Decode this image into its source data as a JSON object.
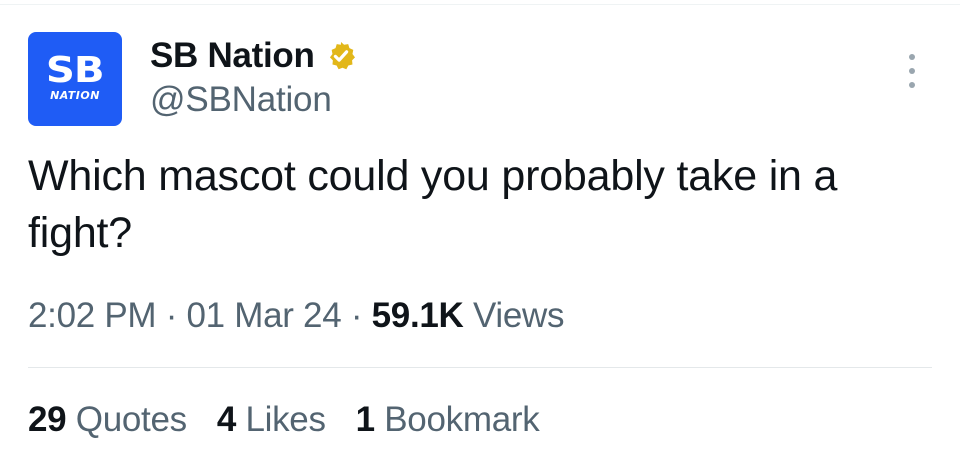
{
  "account": {
    "avatar_text_top": "SB",
    "avatar_text_bottom": "NATION",
    "display_name": "SB Nation",
    "handle": "@SBNation",
    "verified_badge_icon": "verified-badge-gold",
    "avatar_color": "#1f5cf5",
    "badge_color": "#e2b719"
  },
  "tweet": {
    "text": "Which mascot could you probably take in a fight?",
    "time": "2:02 PM",
    "separator": "·",
    "date": "01 Mar 24",
    "views_count": "59.1K",
    "views_label": "Views"
  },
  "stats": {
    "quotes_count": "29",
    "quotes_label": "Quotes",
    "likes_count": "4",
    "likes_label": "Likes",
    "bookmarks_count": "1",
    "bookmarks_label": "Bookmark"
  },
  "more_icon": "more-vertical-icon"
}
